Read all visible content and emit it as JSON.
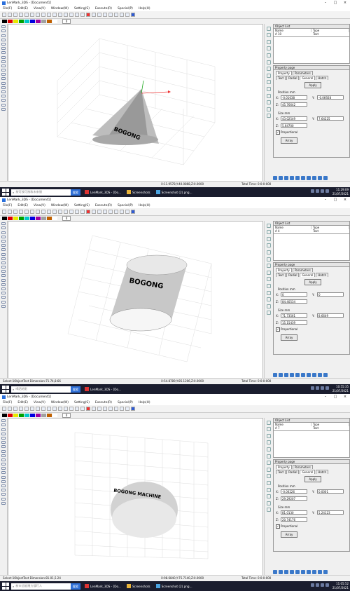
{
  "app": {
    "title": "LenMark_3DS - [Document1]",
    "menus": [
      "File(F)",
      "Edit(E)",
      "View(V)",
      "Window(W)",
      "Setting(S)",
      "Execute(R)",
      "Special(P)",
      "Help(H)"
    ],
    "colors": [
      "#000000",
      "#e00000",
      "#e8e800",
      "#00a000",
      "#00c8c8",
      "#0000e0",
      "#a000a0",
      "#a0a0a0",
      "#c06000",
      "#ffffff"
    ],
    "layer_value": "0"
  },
  "labels": {
    "object_list": "Object List",
    "col_name": "Name",
    "col_type": "Type",
    "property_page": "Property page",
    "tab_property": "Property",
    "tab_parameters": "Parameters",
    "tab_text": "Text",
    "tab_radial": "Radial",
    "tab_general": "General",
    "tab_hatch": "Hatch",
    "apply": "Apply",
    "position_mm": "Position mm",
    "size_mm": "Size   mm",
    "x": "X:",
    "y": "Y:",
    "z": "Z:",
    "proportional": "Proportional",
    "array": "Array",
    "search_button": "搜索"
  },
  "shots": [
    {
      "object": {
        "name": "A 10",
        "type": "Text"
      },
      "text_on_object": "BOGONG",
      "pos": {
        "x": "-0.01638",
        "y": "-0.06928",
        "z": "45.76642"
      },
      "size": {
        "x": "43.02549",
        "y": "7.64225",
        "z": "5.64700"
      },
      "status": {
        "selection": "",
        "coords": "X:11.9578,Y:40.0868,Z:0.0000",
        "time": "Total Time: 0:0:0:000"
      },
      "taskbar": {
        "search_placeholder": "按可按可按和未来服",
        "tasks": [
          "LenMark_3DS - [Do...",
          "Screenshots",
          "Screenshot (2).png..."
        ],
        "time": "11:29:09",
        "date": "21/07/2021"
      }
    },
    {
      "object": {
        "name": "A 4",
        "type": "Text"
      },
      "text_on_object": "BOGONG",
      "pos": {
        "x": "0",
        "y": "0",
        "z": "84.40534"
      },
      "size": {
        "x": "71.73561",
        "y": "8.6649",
        "z": "15.15439"
      },
      "status": {
        "selection": "Select:1ObjectText  Dimension:71.74,8.66",
        "coords": "X:54.8789,Y:85.1206,Z:0.0000",
        "time": "Total Time: 0:0:0:000"
      },
      "taskbar": {
        "search_placeholder": "喝洒地影",
        "tasks": [
          "LenMark_3DS - [Do..."
        ],
        "time": "10:55:35",
        "date": "21/07/2021"
      }
    },
    {
      "object": {
        "name": "A 7",
        "type": "Text"
      },
      "text_on_object": "BOGONG MACHINE",
      "pos": {
        "x": "-0.00226",
        "y": "0.0001",
        "z": "29.29207"
      },
      "size": {
        "x": "81.0130",
        "y": "5.24123",
        "z": "20.74176"
      },
      "status": {
        "selection": "Select:1ObjectText  Dimension:81.01,5.24",
        "coords": "X:98.6840,Y:75.7140,Z:0.0000",
        "time": "Total Time: 0:0:0:000"
      },
      "taskbar": {
        "search_placeholder": "新未信能赠方搜叮人",
        "tasks": [
          "LenMark_3DS - [Do...",
          "Screenshots",
          "Screenshot (2).png..."
        ],
        "time": "11:05:52",
        "date": "21/07/2021"
      }
    }
  ]
}
